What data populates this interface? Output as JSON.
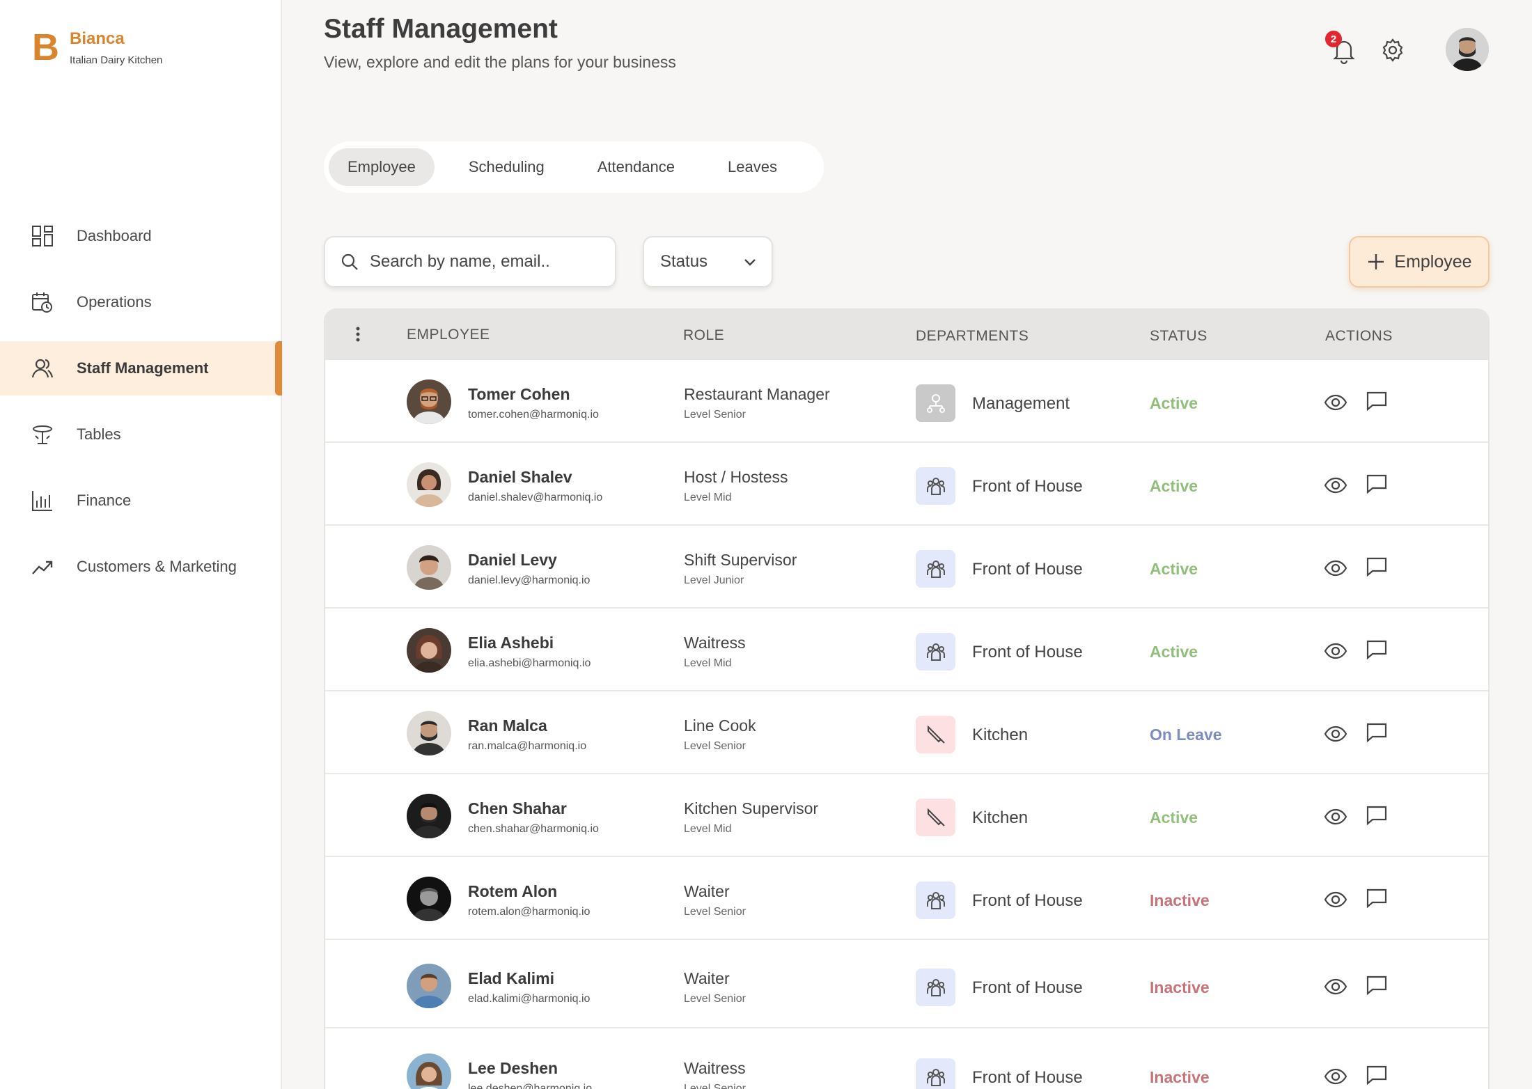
{
  "brand": {
    "letter": "B",
    "name": "Bianca",
    "subtitle": "Italian Dairy Kitchen",
    "color": "#d9852e"
  },
  "nav": [
    {
      "label": "Dashboard",
      "icon": "dashboard-grid-icon"
    },
    {
      "label": "Operations",
      "icon": "calendar-clock-icon"
    },
    {
      "label": "Staff Management",
      "icon": "users-icon",
      "active": true
    },
    {
      "label": "Tables",
      "icon": "table-icon"
    },
    {
      "label": "Finance",
      "icon": "bar-chart-icon"
    },
    {
      "label": "Customers & Marketing",
      "icon": "trending-up-icon"
    }
  ],
  "header": {
    "title": "Staff Management",
    "subtitle": "View, explore and edit the plans for your business",
    "notification_count": "2"
  },
  "tabs": [
    {
      "label": "Employee",
      "active": true
    },
    {
      "label": "Scheduling"
    },
    {
      "label": "Attendance"
    },
    {
      "label": "Leaves"
    }
  ],
  "filters": {
    "search_placeholder": "Search by name, email..",
    "status_label": "Status",
    "add_label": "Employee"
  },
  "table": {
    "columns": {
      "employee": "EMPLOYEE",
      "role": "ROLE",
      "departments": "DEPARTMENTS",
      "status": "STATUS",
      "actions": "ACTIONS"
    },
    "rows": [
      {
        "name": "Tomer Cohen",
        "email": "tomer.cohen@harmoniq.io",
        "role": "Restaurant Manager",
        "level": "Level Senior",
        "department": "Management",
        "status": "Active"
      },
      {
        "name": "Daniel Shalev",
        "email": "daniel.shalev@harmoniq.io",
        "role": "Host / Hostess",
        "level": "Level Mid",
        "department": "Front of House",
        "status": "Active"
      },
      {
        "name": "Daniel Levy",
        "email": "daniel.levy@harmoniq.io",
        "role": "Shift Supervisor",
        "level": "Level Junior",
        "department": "Front of House",
        "status": "Active"
      },
      {
        "name": "Elia Ashebi",
        "email": "elia.ashebi@harmoniq.io",
        "role": "Waitress",
        "level": "Level Mid",
        "department": "Front of House",
        "status": "Active"
      },
      {
        "name": "Ran Malca",
        "email": "ran.malca@harmoniq.io",
        "role": "Line Cook",
        "level": "Level Senior",
        "department": "Kitchen",
        "status": "On Leave"
      },
      {
        "name": "Chen Shahar",
        "email": "chen.shahar@harmoniq.io",
        "role": "Kitchen Supervisor",
        "level": "Level Mid",
        "department": "Kitchen",
        "status": "Active"
      },
      {
        "name": "Rotem Alon",
        "email": "rotem.alon@harmoniq.io",
        "role": "Waiter",
        "level": "Level Senior",
        "department": "Front of House",
        "status": "Inactive"
      },
      {
        "name": "Elad Kalimi",
        "email": "elad.kalimi@harmoniq.io",
        "role": "Waiter",
        "level": "Level Senior",
        "department": "Front of House",
        "status": "Inactive"
      },
      {
        "name": "Lee Deshen",
        "email": "lee.deshen@harmoniq.io",
        "role": "Waitress",
        "level": "Level Senior",
        "department": "Front of House",
        "status": "Inactive"
      }
    ]
  },
  "colors": {
    "accent": "#e08a3c",
    "active": "#8fbf79",
    "on_leave": "#7b8cc2",
    "inactive": "#c87377"
  }
}
